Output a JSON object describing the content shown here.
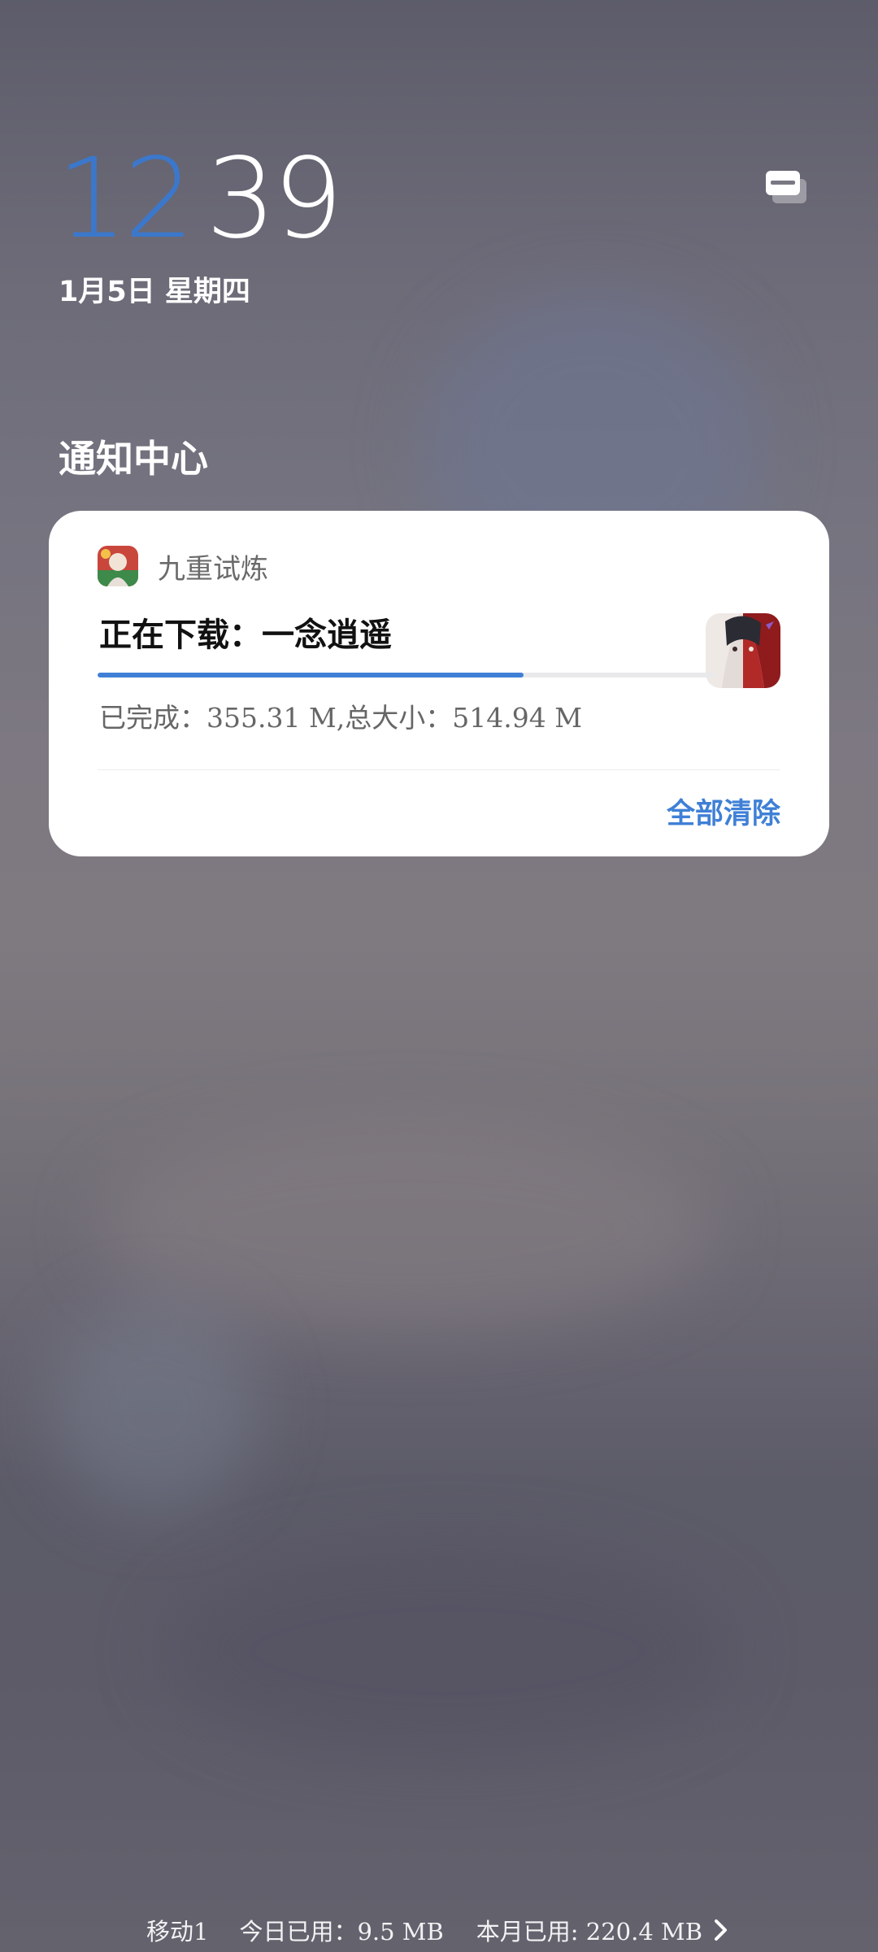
{
  "lockscreen": {
    "time_hours": "12",
    "time_minutes": "39",
    "date": "1月5日 星期四",
    "notification_toggle_icon": "notification-style-icon"
  },
  "notification_center": {
    "title": "通知中心"
  },
  "notification": {
    "app_icon": "game-app-icon",
    "app_name": "九重试炼",
    "title": "正在下载：一念逍遥",
    "thumbnail_icon": "game-thumbnail",
    "progress_fraction": 0.69,
    "status": "已完成：355.31 M,总大小：514.94 M",
    "clear_all_label": "全部清除"
  },
  "footer": {
    "carrier": "移动1",
    "today_usage": "今日已用：9.5 MB",
    "month_usage": "本月已用: 220.4 MB",
    "chevron_icon": "chevron-right-icon"
  },
  "colors": {
    "accent": "#3f80d6",
    "clock_hours": "#3b78cc"
  }
}
